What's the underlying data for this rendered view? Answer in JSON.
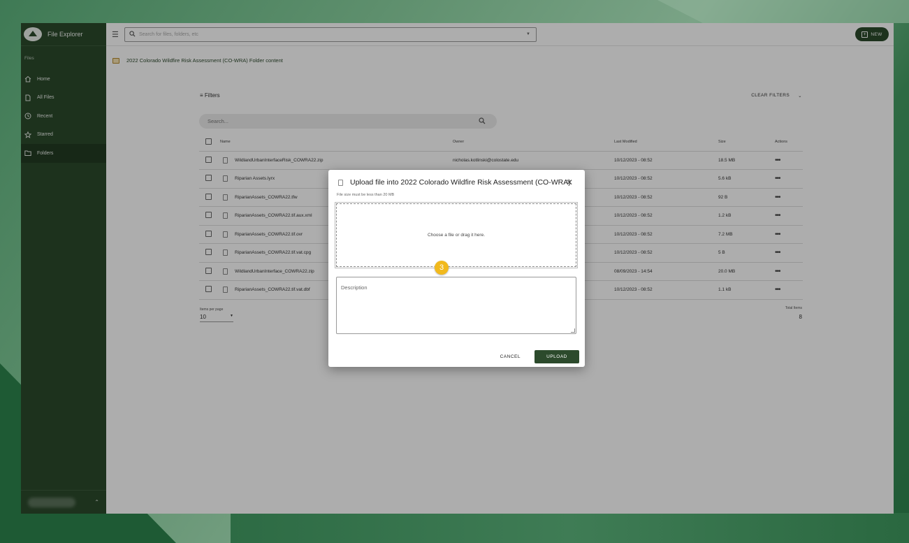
{
  "app": {
    "title": "File Explorer"
  },
  "sidebar": {
    "section_label": "Files",
    "items": [
      {
        "label": "Home",
        "icon": "home-icon"
      },
      {
        "label": "All Files",
        "icon": "file-icon"
      },
      {
        "label": "Recent",
        "icon": "clock-icon"
      },
      {
        "label": "Starred",
        "icon": "star-icon"
      },
      {
        "label": "Folders",
        "icon": "folder-icon",
        "active": true
      }
    ]
  },
  "topbar": {
    "search_placeholder": "Search for files, folders, etc",
    "new_label": "NEW"
  },
  "breadcrumb": {
    "text": "2022 Colorado Wildfire Risk Assessment (CO-WRA) Folder content"
  },
  "filters": {
    "label": "Filters",
    "clear_label": "CLEAR FILTERS"
  },
  "table_search": {
    "placeholder": "Search..."
  },
  "table": {
    "headers": [
      "Name",
      "Owner",
      "Last Modified",
      "Size",
      "Actions"
    ],
    "rows": [
      {
        "name": "WildlandUrbanInterfaceRisk_COWRA22.zip",
        "owner": "nicholas.kotlinski@colostate.edu",
        "modified": "10/12/2023 - 08:52",
        "size": "18.5 MB"
      },
      {
        "name": "Riparian Assets.lyrx",
        "owner": "",
        "modified": "10/12/2023 - 08:52",
        "size": "5.6 kB"
      },
      {
        "name": "RiparianAssets_COWRA22.tfw",
        "owner": "",
        "modified": "10/12/2023 - 08:52",
        "size": "92 B"
      },
      {
        "name": "RiparianAssets_COWRA22.tif.aux.xml",
        "owner": "",
        "modified": "10/12/2023 - 08:52",
        "size": "1.2 kB"
      },
      {
        "name": "RiparianAssets_COWRA22.tif.ovr",
        "owner": "",
        "modified": "10/12/2023 - 08:52",
        "size": "7.2 MB"
      },
      {
        "name": "RiparianAssets_COWRA22.tif.vat.cpg",
        "owner": "",
        "modified": "10/12/2023 - 08:52",
        "size": "5 B"
      },
      {
        "name": "WildlandUrbanInterface_COWRA22.zip",
        "owner": "",
        "modified": "08/09/2023 - 14:54",
        "size": "20.0 MB"
      },
      {
        "name": "RiparianAssets_COWRA22.tif.vat.dbf",
        "owner": "",
        "modified": "10/12/2023 - 08:52",
        "size": "1.1 kB"
      }
    ]
  },
  "pagination": {
    "items_per_page_label": "Items per page",
    "items_per_page": "10",
    "total_label": "Total Items",
    "total": "8"
  },
  "dialog": {
    "title": "Upload file into 2022 Colorado Wildfire Risk Assessment (CO-WRA)",
    "hint": "File size must be less than 20 MB",
    "dropzone_text": "Choose a file or drag it here.",
    "description_placeholder": "Description",
    "step_badge": "3",
    "cancel_label": "CANCEL",
    "upload_label": "UPLOAD"
  },
  "colors": {
    "sidebar": "#2c4a2c",
    "accent": "#2c4a2c",
    "badge": "#f1b91d"
  }
}
